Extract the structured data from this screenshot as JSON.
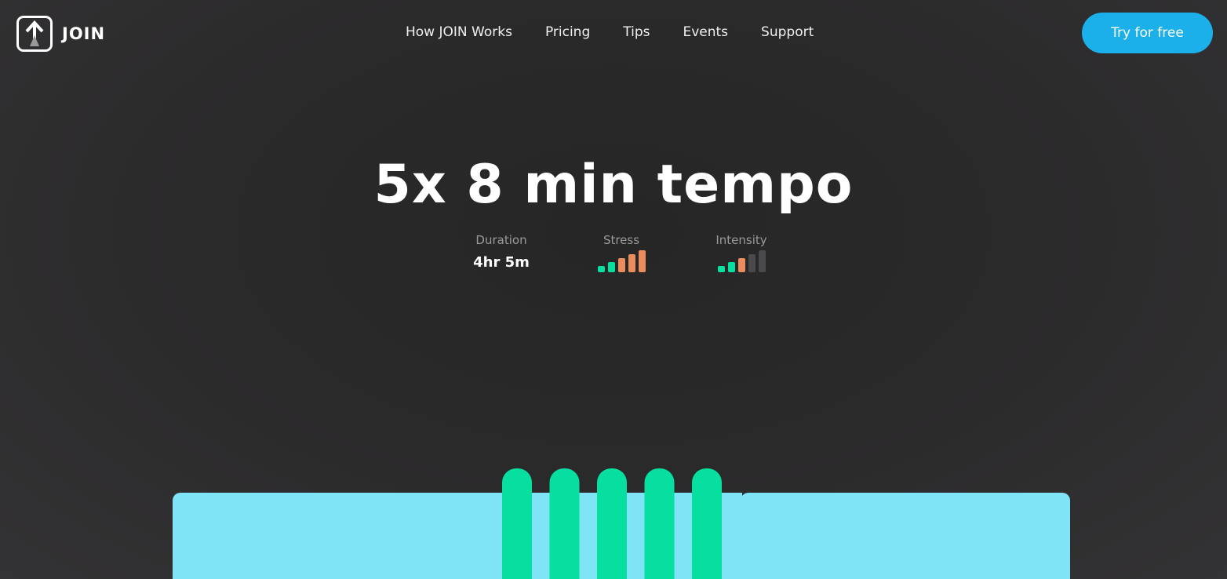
{
  "brand": {
    "name": "JOIN",
    "logo_icon": "arrow-up-icon"
  },
  "nav": {
    "links": [
      "How JOIN Works",
      "Pricing",
      "Tips",
      "Events",
      "Support"
    ],
    "cta": "Try for free"
  },
  "workout": {
    "title": "5x 8 min tempo",
    "duration": {
      "label": "Duration",
      "value": "4hr 5m"
    },
    "stress": {
      "label": "Stress",
      "level": 5,
      "max": 5
    },
    "intensity": {
      "label": "Intensity",
      "level": 3,
      "max": 5
    }
  },
  "colors": {
    "accent": "#1cb0ea",
    "green": "#06dfa0",
    "orange": "#ea8c5e",
    "inactive": "#4a4a4c",
    "block": "#80e4f7"
  },
  "chart_data": {
    "type": "bar",
    "description_blocks": [
      "warmup",
      "5 intervals",
      "cooldown"
    ],
    "interval_count": 5
  }
}
